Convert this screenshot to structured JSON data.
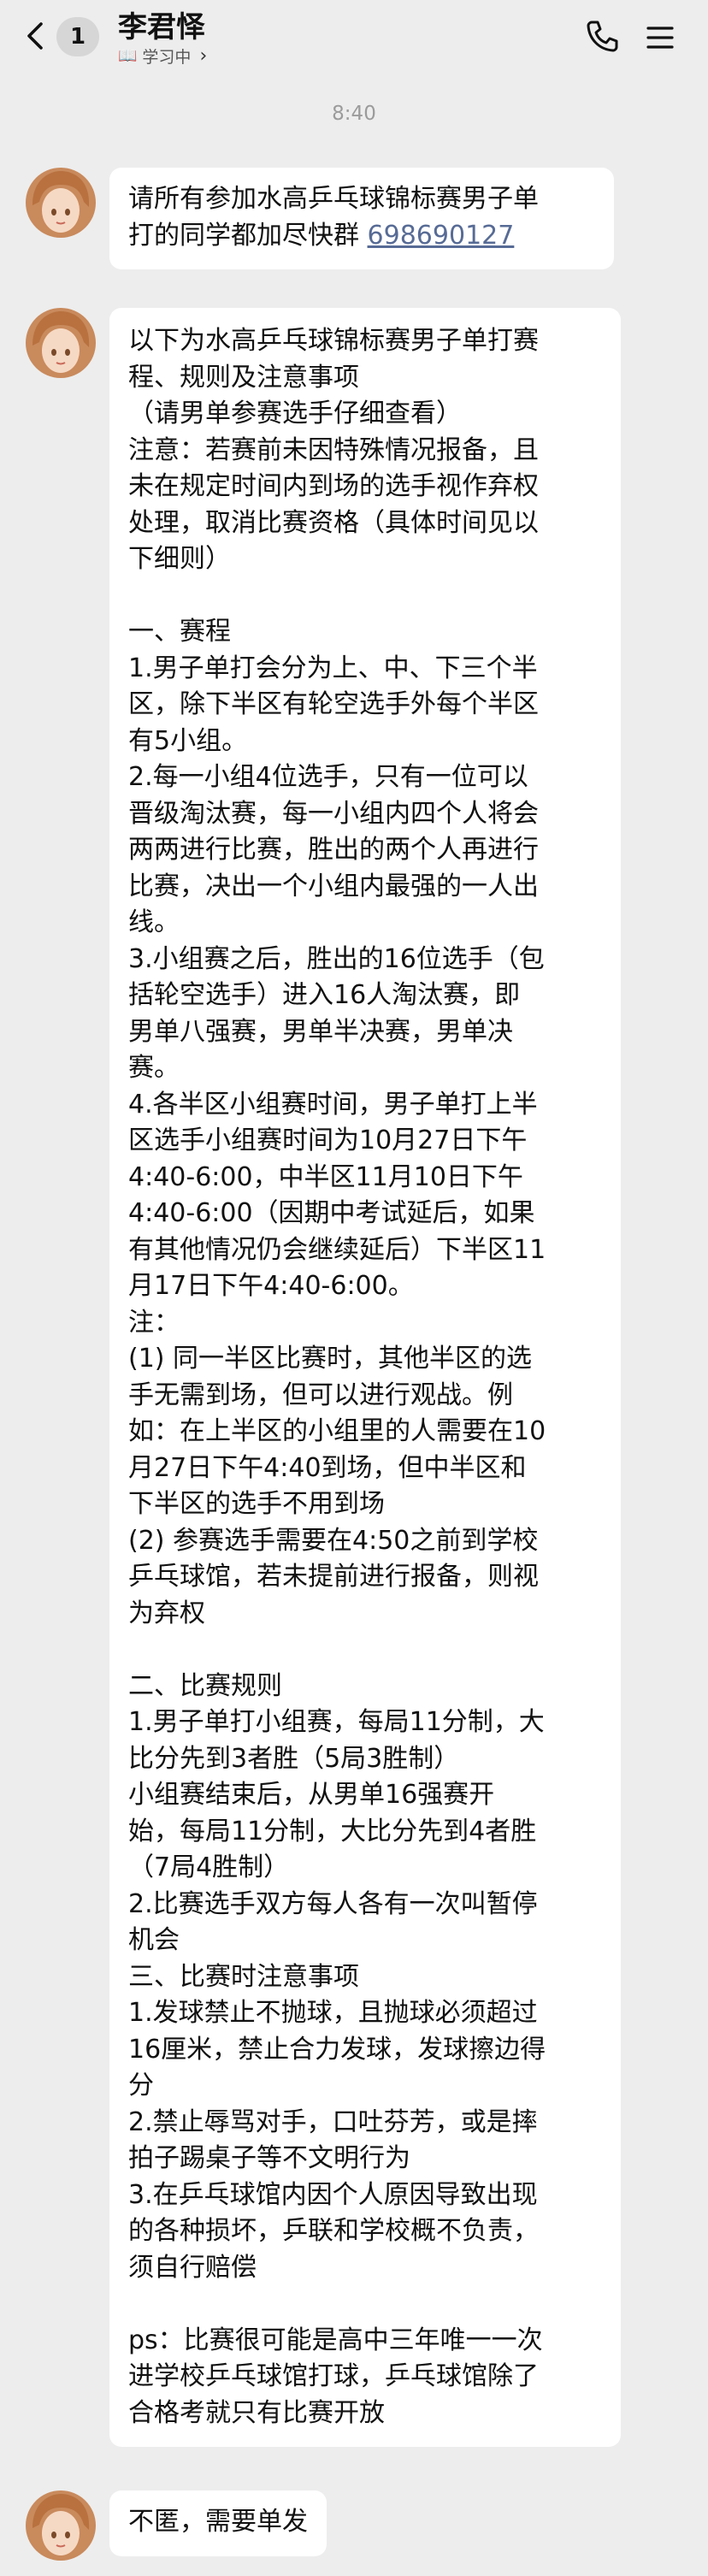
{
  "header": {
    "badge_count": "1",
    "contact_name": "李君怿",
    "status": "学习中"
  },
  "chat": {
    "timestamp": "8:40",
    "messages": [
      {
        "lines": [
          "请所有参加水高乒乓球锦标赛男子单",
          "打的同学都加尽快群 "
        ],
        "link": "698690127"
      },
      {
        "lines": [
          "以下为水高乒乓球锦标赛男子单打赛",
          "程、规则及注意事项",
          "（请男单参赛选手仔细查看）",
          "注意：若赛前未因特殊情况报备，且",
          "未在规定时间内到场的选手视作弃权",
          "处理，取消比赛资格（具体时间见以",
          "下细则）",
          "",
          "一、赛程",
          "1.男子单打会分为上、中、下三个半",
          "区，除下半区有轮空选手外每个半区",
          "有5小组。",
          "2.每一小组4位选手，只有一位可以",
          "晋级淘汰赛，每一小组内四个人将会",
          "两两进行比赛，胜出的两个人再进行",
          "比赛，决出一个小组内最强的一人出",
          "线。",
          "3.小组赛之后，胜出的16位选手（包",
          "括轮空选手）进入16人淘汰赛，即",
          "男单八强赛，男单半决赛，男单决",
          "赛。",
          "4.各半区小组赛时间，男子单打上半",
          "区选手小组赛时间为10月27日下午",
          "4:40-6:00，中半区11月10日下午",
          "4:40-6:00（因期中考试延后，如果",
          "有其他情况仍会继续延后）下半区11",
          "月17日下午4:40-6:00。",
          "注：",
          "(1) 同一半区比赛时，其他半区的选",
          "手无需到场，但可以进行观战。例",
          "如：在上半区的小组里的人需要在10",
          "月27日下午4:40到场，但中半区和",
          "下半区的选手不用到场",
          "(2) 参赛选手需要在4:50之前到学校",
          "乒乓球馆，若未提前进行报备，则视",
          "为弃权",
          "",
          "二、比赛规则",
          "1.男子单打小组赛，每局11分制，大",
          "比分先到3者胜（5局3胜制）",
          "小组赛结束后，从男单16强赛开",
          "始，每局11分制，大比分先到4者胜",
          "（7局4胜制）",
          "2.比赛选手双方每人各有一次叫暂停",
          "机会",
          "三、比赛时注意事项",
          "1.发球禁止不抛球，且抛球必须超过",
          "16厘米，禁止合力发球，发球擦边得",
          "分",
          "2.禁止辱骂对手，口吐芬芳，或是摔",
          "拍子踢桌子等不文明行为",
          "3.在乒乓球馆内因个人原因导致出现",
          "的各种损坏，乒联和学校概不负责，",
          "须自行赔偿",
          "",
          "ps：比赛很可能是高中三年唯一一次",
          "进学校乒乓球馆打球，乒乓球馆除了",
          "合格考就只有比赛开放"
        ]
      },
      {
        "lines": [
          "不匿，需要单发"
        ]
      }
    ]
  },
  "colors": {
    "background": "#ededed",
    "bubble": "#ffffff",
    "link": "#576b95"
  }
}
